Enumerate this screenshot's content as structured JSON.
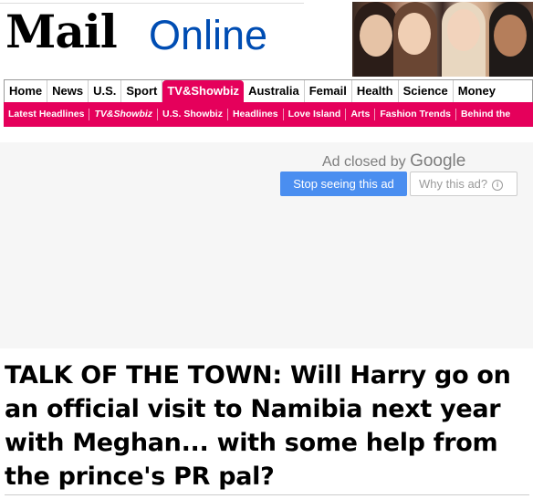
{
  "masthead": {
    "logo_mail": "Mail",
    "logo_online": "Online",
    "brand_color": "#004db3"
  },
  "nav_primary": {
    "items": [
      "Home",
      "News",
      "U.S.",
      "Sport",
      "TV&Showbiz",
      "Australia",
      "Femail",
      "Health",
      "Science",
      "Money"
    ],
    "active": "TV&Showbiz",
    "accent_color": "#e5005b"
  },
  "nav_secondary": {
    "items": [
      "Latest Headlines",
      "TV&Showbiz",
      "U.S. Showbiz",
      "Headlines",
      "Love Island",
      "Arts",
      "Fashion Trends",
      "Behind the"
    ]
  },
  "ad": {
    "closed_text": "Ad closed by",
    "google": "Google",
    "stop_label": "Stop seeing this ad",
    "why_label": "Why this ad?",
    "info_icon": "i"
  },
  "article": {
    "headline": "TALK OF THE TOWN: Will Harry go on an official visit to Namibia next year with Meghan... with some help from the prince's PR pal?"
  }
}
